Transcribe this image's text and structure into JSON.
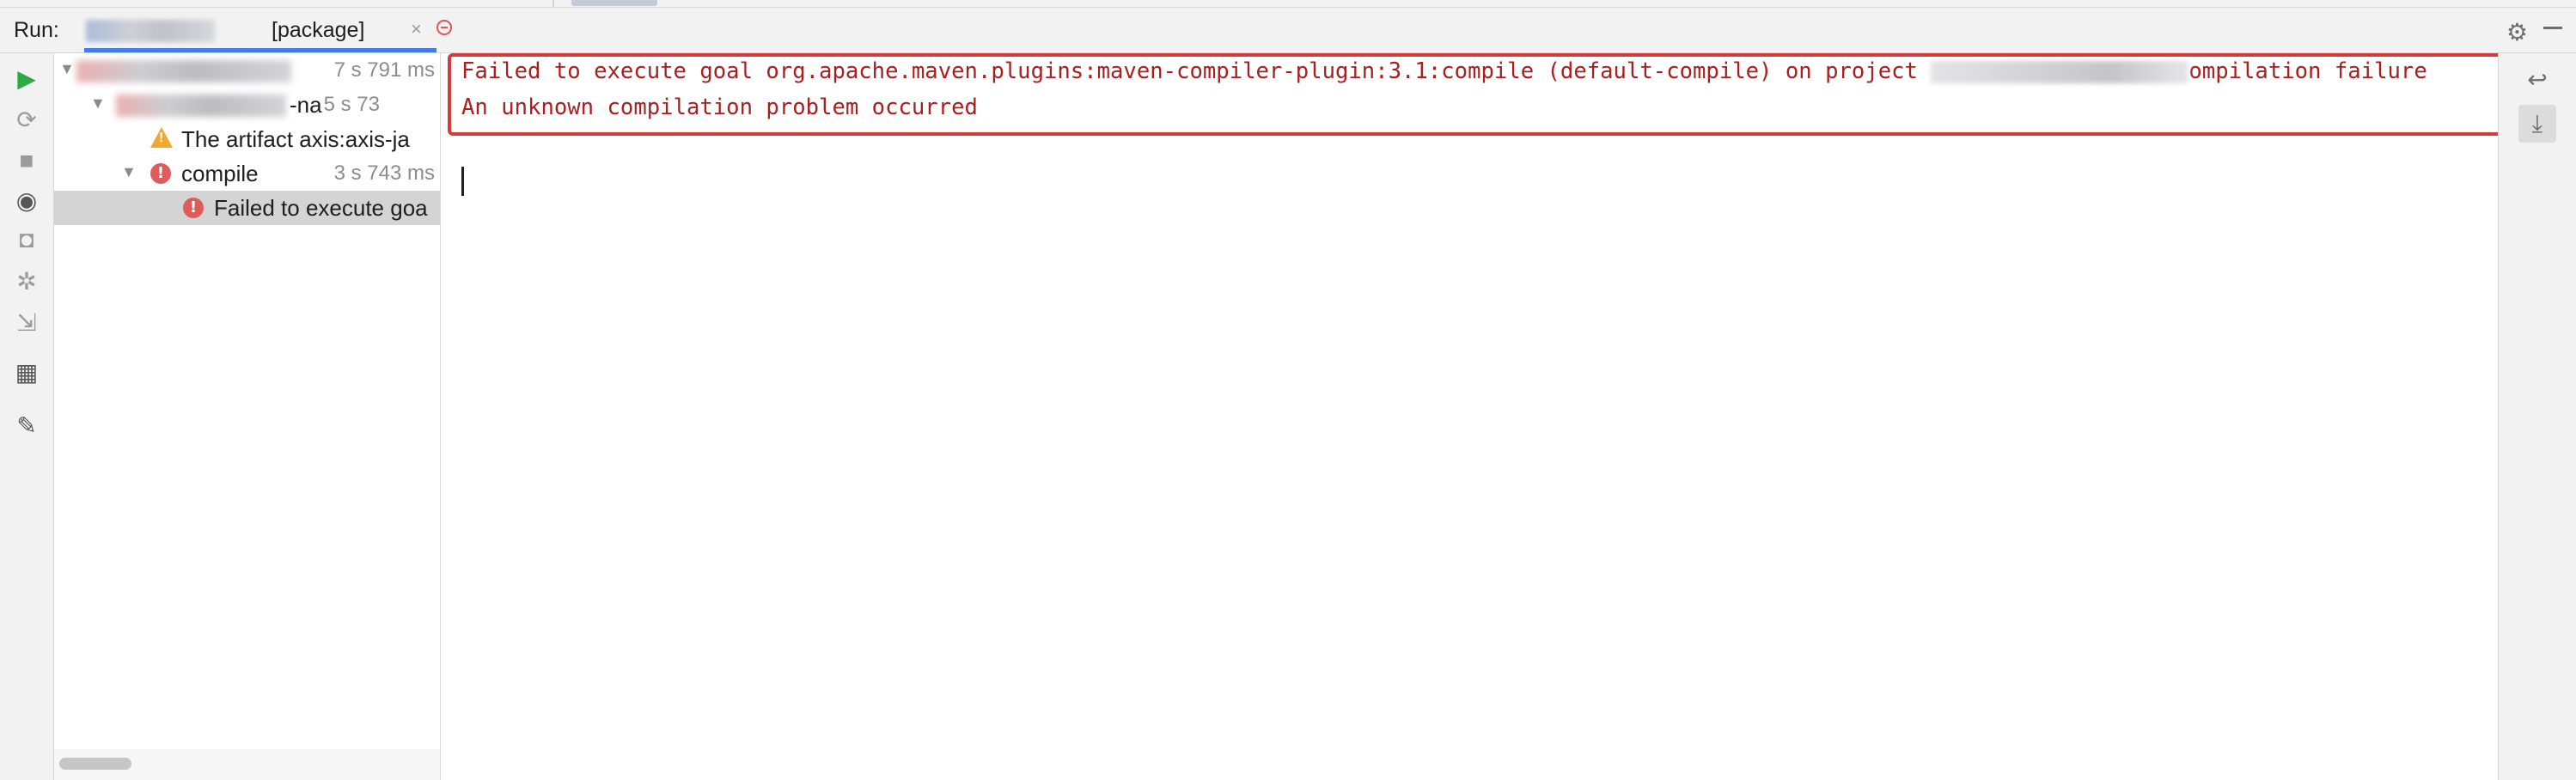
{
  "header": {
    "run_label": "Run:",
    "tab_title": "[package]",
    "close_glyph": "×",
    "settings_icon": "gear-icon",
    "minimize_icon": "minimize-icon"
  },
  "left_toolbar": {
    "icons": [
      "run-icon",
      "rerun-failed-icon",
      "stop-icon",
      "show-options-icon",
      "screenshot-icon",
      "debug-icon",
      "export-icon",
      "layout-icon",
      "pin-icon"
    ]
  },
  "tree": {
    "rows": [
      {
        "label": "",
        "time": "7 s 791 ms",
        "status": "error"
      },
      {
        "label": "-na",
        "time": "5 s 73",
        "status": "error"
      },
      {
        "label": "The artifact axis:axis-ja",
        "time": "",
        "status": "warning"
      },
      {
        "label": "compile",
        "time": "3 s 743 ms",
        "status": "error"
      },
      {
        "label": "Failed to execute goa",
        "time": "",
        "status": "error"
      }
    ]
  },
  "console": {
    "line1_prefix": "Failed to execute goal org.apache.maven.plugins:maven-compiler-plugin:3.1:compile (default-compile) on project ",
    "line1_suffix": "ompilation failure",
    "line2": "An unknown compilation problem occurred"
  },
  "right_toolbar": {
    "icons": [
      "soft-wrap-icon",
      "scroll-to-end-icon"
    ]
  },
  "colors": {
    "error_text": "#a81f1f",
    "highlight_border": "#d63a3a",
    "tab_underline": "#3f7ee8",
    "run_green": "#2fa847"
  }
}
